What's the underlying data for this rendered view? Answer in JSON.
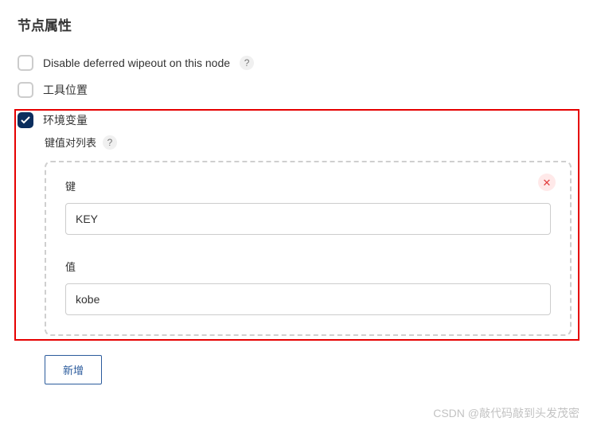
{
  "title": "节点属性",
  "options": {
    "disable_wipeout": {
      "label": "Disable deferred wipeout on this node",
      "checked": false
    },
    "tool_location": {
      "label": "工具位置",
      "checked": false
    },
    "env_vars": {
      "label": "环境变量",
      "checked": true
    }
  },
  "env": {
    "kv_list_label": "键值对列表",
    "key_label": "键",
    "value_label": "值",
    "key_value": "KEY",
    "value_value": "kobe",
    "add_label": "新增"
  },
  "icons": {
    "help": "?",
    "close": "✕"
  },
  "watermark": "CSDN @敲代码敲到头发茂密"
}
